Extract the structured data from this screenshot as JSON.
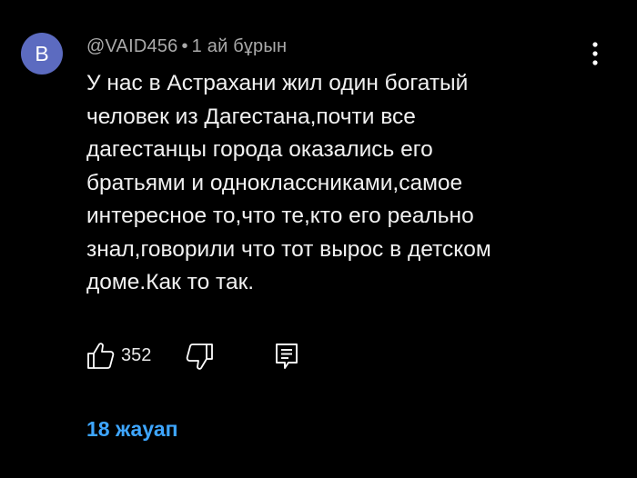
{
  "comment": {
    "avatar_letter": "B",
    "avatar_color": "#5c6bc0",
    "author": "@VAID456",
    "separator": "•",
    "timestamp": "1 ай бұрын",
    "text_lines": [
      "У нас в Астрахани жил один богатый",
      "человек из Дагестана,почти все",
      "дагестанцы города оказались его",
      "братьями и одноклассниками,самое",
      "интересное то,что те,кто его реально",
      "знал,говорили что тот вырос в детском",
      "доме.Как то так."
    ],
    "like_count": "352",
    "replies_label": "18 жауап",
    "accent_color": "#3ea6ff"
  },
  "icons": {
    "more": "more-vertical-icon",
    "like": "thumbs-up-icon",
    "dislike": "thumbs-down-icon",
    "reply": "reply-comment-icon"
  }
}
